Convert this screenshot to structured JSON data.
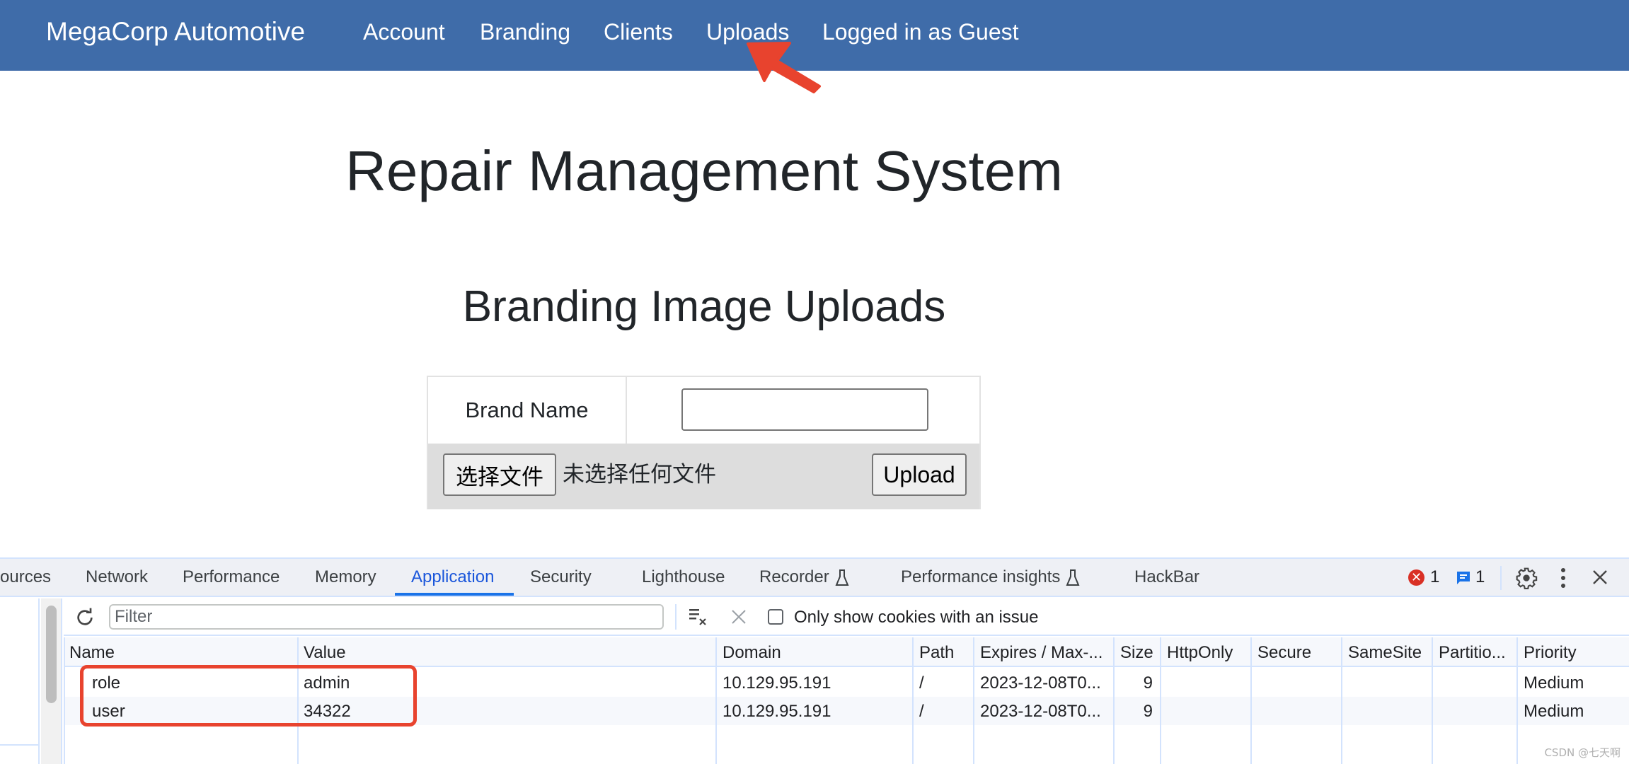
{
  "navbar": {
    "brand": "MegaCorp Automotive",
    "links": [
      "Account",
      "Branding",
      "Clients",
      "Uploads",
      "Logged in as Guest"
    ],
    "color": "#3f6ca9"
  },
  "page": {
    "title": "Repair Management System",
    "subtitle": "Branding Image Uploads"
  },
  "form": {
    "brand_label": "Brand Name",
    "brand_value": "",
    "choose_file_label": "选择文件",
    "no_file_text": "未选择任何文件",
    "upload_label": "Upload"
  },
  "devtools": {
    "tabs": [
      "ources",
      "Network",
      "Performance",
      "Memory",
      "Application",
      "Security",
      "Lighthouse",
      "Recorder",
      "Performance insights",
      "HackBar"
    ],
    "active_tab": "Application",
    "error_count": "1",
    "message_count": "1",
    "toolbar": {
      "filter_placeholder": "Filter",
      "filter_value": "",
      "only_issue_label": "Only show cookies with an issue",
      "only_issue_checked": false
    },
    "cookies": {
      "columns": [
        "Name",
        "Value",
        "Domain",
        "Path",
        "Expires / Max-...",
        "Size",
        "HttpOnly",
        "Secure",
        "SameSite",
        "Partitio...",
        "Priority"
      ],
      "rows": [
        [
          "role",
          "admin",
          "10.129.95.191",
          "/",
          "2023-12-08T0...",
          "9",
          "",
          "",
          "",
          "",
          "Medium"
        ],
        [
          "user",
          "34322",
          "10.129.95.191",
          "/",
          "2023-12-08T0...",
          "9",
          "",
          "",
          "",
          "",
          "Medium"
        ]
      ]
    }
  },
  "annotation_color": "#e8432e",
  "watermark": "CSDN @七天啊"
}
